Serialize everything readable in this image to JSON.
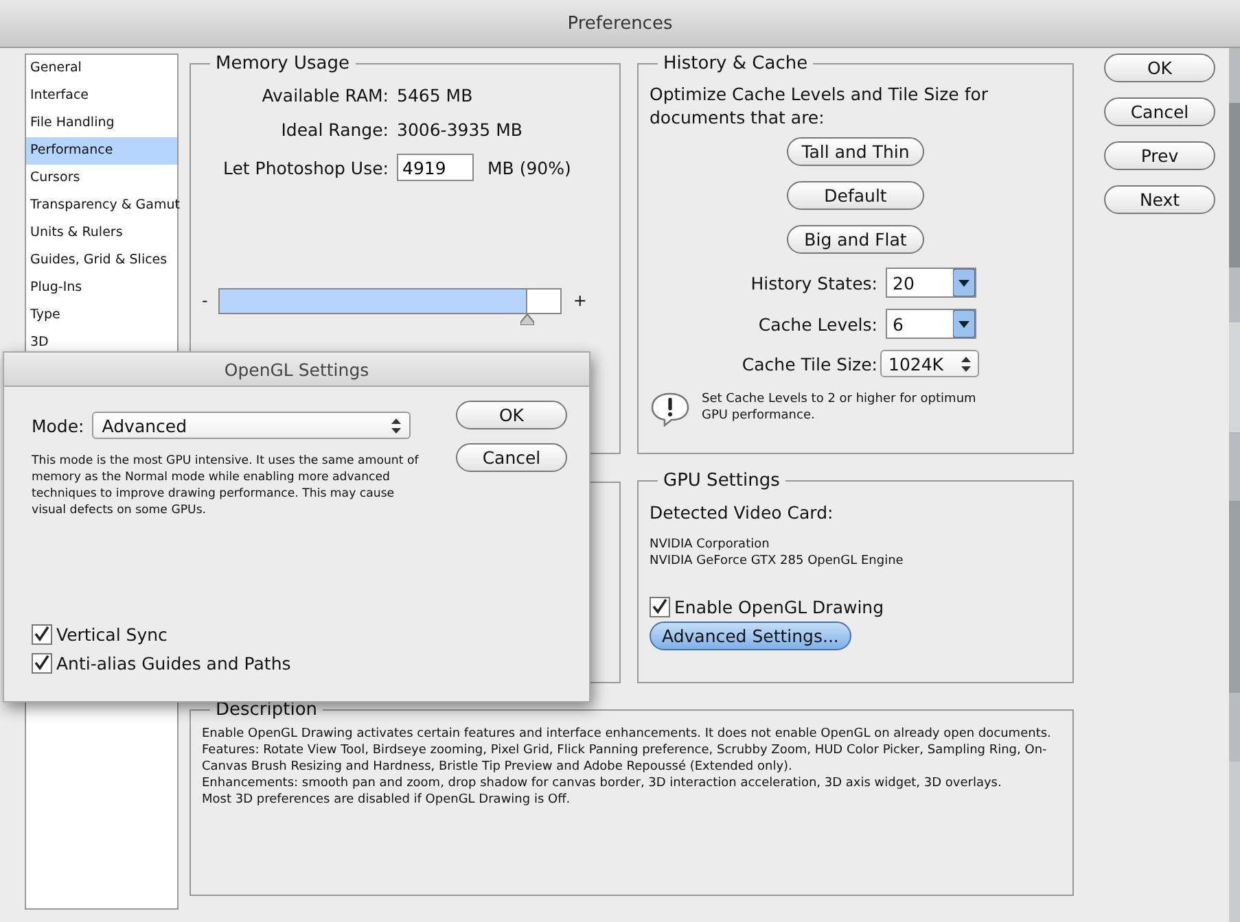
{
  "window": {
    "title": "Preferences"
  },
  "sidebar": {
    "items": [
      {
        "label": "General",
        "selected": false
      },
      {
        "label": "Interface",
        "selected": false
      },
      {
        "label": "File Handling",
        "selected": false
      },
      {
        "label": "Performance",
        "selected": true
      },
      {
        "label": "Cursors",
        "selected": false
      },
      {
        "label": "Transparency & Gamut",
        "selected": false
      },
      {
        "label": "Units & Rulers",
        "selected": false
      },
      {
        "label": "Guides, Grid & Slices",
        "selected": false
      },
      {
        "label": "Plug-Ins",
        "selected": false
      },
      {
        "label": "Type",
        "selected": false
      },
      {
        "label": "3D",
        "selected": false
      }
    ]
  },
  "memory_usage": {
    "title": "Memory Usage",
    "rows": [
      {
        "kind": "text",
        "label": "Available RAM:",
        "value": "5465 MB"
      },
      {
        "kind": "text",
        "label": "Ideal Range:",
        "value": "3006-3935 MB"
      },
      {
        "kind": "input",
        "label": "Let Photoshop Use:",
        "value": "4919",
        "unit": "MB (90%)"
      }
    ],
    "slider": {
      "minus": "-",
      "plus": "+",
      "level": 0.9
    }
  },
  "history_cache": {
    "title": "History & Cache",
    "intro": "Optimize Cache Levels and Tile Size for documents that are:",
    "presets": [
      "Tall and Thin",
      "Default",
      "Big and Flat"
    ],
    "fields": [
      {
        "kind": "dropdown",
        "label": "History States:",
        "value": "20"
      },
      {
        "kind": "dropdown",
        "label": "Cache Levels:",
        "value": "6"
      },
      {
        "kind": "stepper",
        "label": "Cache Tile Size:",
        "value": "1024K"
      }
    ],
    "note": "Set Cache Levels to 2 or higher for optimum GPU performance."
  },
  "gpu_settings": {
    "title": "GPU Settings",
    "card_label": "Detected Video Card:",
    "card_lines": [
      "NVIDIA Corporation",
      "NVIDIA GeForce GTX 285 OpenGL Engine"
    ],
    "enable_opengl": {
      "label": "Enable OpenGL Drawing",
      "checked": true
    },
    "advanced_button": "Advanced Settings..."
  },
  "description": {
    "title": "Description",
    "paragraphs": [
      "Enable OpenGL Drawing activates certain features and interface enhancements. It does not enable OpenGL on already open documents.",
      "Features: Rotate View Tool, Birdseye zooming, Pixel Grid, Flick Panning preference, Scrubby Zoom, HUD Color Picker, Sampling Ring, On-Canvas Brush Resizing and Hardness, Bristle Tip Preview and Adobe Repoussé (Extended only).",
      "Enhancements: smooth pan and zoom, drop shadow for canvas border, 3D interaction acceleration, 3D axis widget, 3D overlays.",
      "Most 3D preferences are disabled if OpenGL Drawing is Off."
    ]
  },
  "buttons": [
    "OK",
    "Cancel",
    "Prev",
    "Next"
  ],
  "opengl_dialog": {
    "title": "OpenGL Settings",
    "mode_label": "Mode:",
    "mode_value": "Advanced",
    "explanation": "This mode is the most GPU intensive.  It uses the same amount of memory as the Normal mode while enabling more advanced techniques to improve drawing performance.  This may cause visual defects on some GPUs.",
    "buttons": [
      "OK",
      "Cancel"
    ],
    "options": [
      {
        "label": "Vertical Sync",
        "checked": true
      },
      {
        "label": "Anti-alias Guides and Paths",
        "checked": true
      }
    ]
  }
}
